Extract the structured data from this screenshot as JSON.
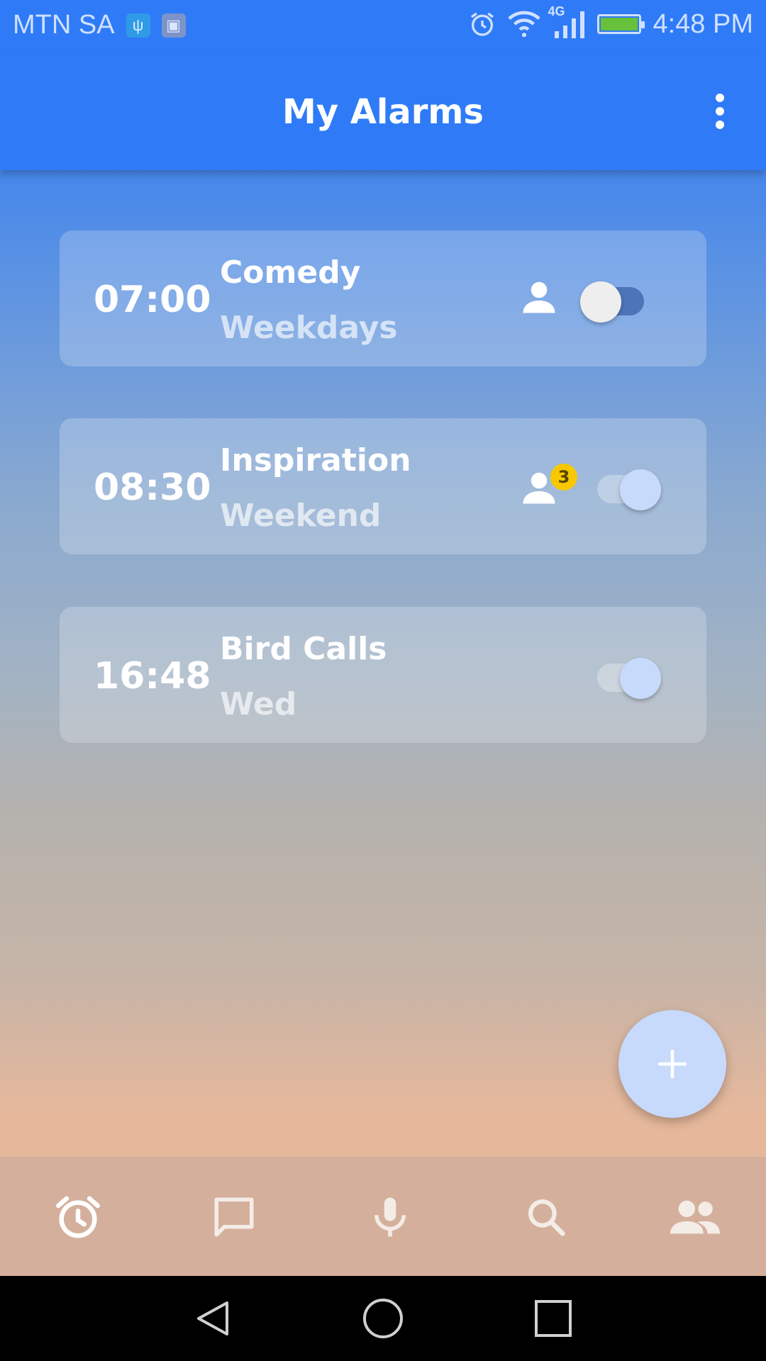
{
  "status_bar": {
    "carrier": "MTN SA",
    "network_type": "4G",
    "time": "4:48 PM",
    "icons_left": [
      "usb-icon",
      "image-icon"
    ],
    "icons_right": [
      "alarm-clock-icon",
      "wifi-icon",
      "signal-icon",
      "battery-charging-icon"
    ]
  },
  "app_bar": {
    "title": "My Alarms",
    "menu_icon": "more-vertical-icon"
  },
  "alarms": [
    {
      "time": "07:00",
      "name": "Comedy",
      "days": "Weekdays",
      "shared_icon": "person-icon",
      "badge": "",
      "enabled": false
    },
    {
      "time": "08:30",
      "name": "Inspiration",
      "days": "Weekend",
      "shared_icon": "person-icon",
      "badge": "3",
      "enabled": true
    },
    {
      "time": "16:48",
      "name": "Bird Calls",
      "days": "Wed",
      "shared_icon": "",
      "badge": "",
      "enabled": true
    }
  ],
  "fab": {
    "icon": "plus-icon"
  },
  "bottom_nav": {
    "items": [
      {
        "icon": "alarm-icon",
        "active": true
      },
      {
        "icon": "chat-icon",
        "active": false
      },
      {
        "icon": "microphone-icon",
        "active": false
      },
      {
        "icon": "search-icon",
        "active": false
      },
      {
        "icon": "people-icon",
        "active": false
      }
    ]
  },
  "system_nav": {
    "buttons": [
      "back-icon",
      "home-icon",
      "recents-icon"
    ]
  },
  "colors": {
    "primary": "#2f7bf7",
    "fab": "#c7dafc",
    "badge": "#f7c800",
    "bottom_nav_bg": "#d4b09c"
  }
}
